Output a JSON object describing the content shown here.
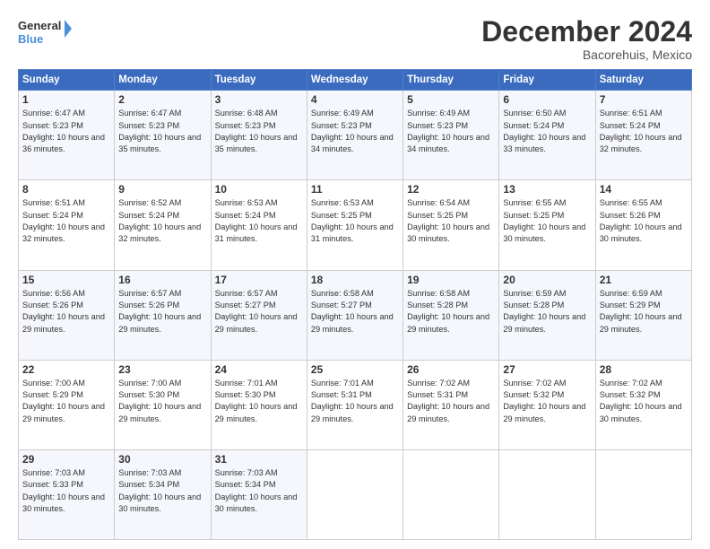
{
  "logo": {
    "general": "General",
    "blue": "Blue"
  },
  "header": {
    "month": "December 2024",
    "location": "Bacorehuis, Mexico"
  },
  "weekdays": [
    "Sunday",
    "Monday",
    "Tuesday",
    "Wednesday",
    "Thursday",
    "Friday",
    "Saturday"
  ],
  "weeks": [
    [
      {
        "day": "1",
        "sunrise": "Sunrise: 6:47 AM",
        "sunset": "Sunset: 5:23 PM",
        "daylight": "Daylight: 10 hours and 36 minutes."
      },
      {
        "day": "2",
        "sunrise": "Sunrise: 6:47 AM",
        "sunset": "Sunset: 5:23 PM",
        "daylight": "Daylight: 10 hours and 35 minutes."
      },
      {
        "day": "3",
        "sunrise": "Sunrise: 6:48 AM",
        "sunset": "Sunset: 5:23 PM",
        "daylight": "Daylight: 10 hours and 35 minutes."
      },
      {
        "day": "4",
        "sunrise": "Sunrise: 6:49 AM",
        "sunset": "Sunset: 5:23 PM",
        "daylight": "Daylight: 10 hours and 34 minutes."
      },
      {
        "day": "5",
        "sunrise": "Sunrise: 6:49 AM",
        "sunset": "Sunset: 5:23 PM",
        "daylight": "Daylight: 10 hours and 34 minutes."
      },
      {
        "day": "6",
        "sunrise": "Sunrise: 6:50 AM",
        "sunset": "Sunset: 5:24 PM",
        "daylight": "Daylight: 10 hours and 33 minutes."
      },
      {
        "day": "7",
        "sunrise": "Sunrise: 6:51 AM",
        "sunset": "Sunset: 5:24 PM",
        "daylight": "Daylight: 10 hours and 32 minutes."
      }
    ],
    [
      {
        "day": "8",
        "sunrise": "Sunrise: 6:51 AM",
        "sunset": "Sunset: 5:24 PM",
        "daylight": "Daylight: 10 hours and 32 minutes."
      },
      {
        "day": "9",
        "sunrise": "Sunrise: 6:52 AM",
        "sunset": "Sunset: 5:24 PM",
        "daylight": "Daylight: 10 hours and 32 minutes."
      },
      {
        "day": "10",
        "sunrise": "Sunrise: 6:53 AM",
        "sunset": "Sunset: 5:24 PM",
        "daylight": "Daylight: 10 hours and 31 minutes."
      },
      {
        "day": "11",
        "sunrise": "Sunrise: 6:53 AM",
        "sunset": "Sunset: 5:25 PM",
        "daylight": "Daylight: 10 hours and 31 minutes."
      },
      {
        "day": "12",
        "sunrise": "Sunrise: 6:54 AM",
        "sunset": "Sunset: 5:25 PM",
        "daylight": "Daylight: 10 hours and 30 minutes."
      },
      {
        "day": "13",
        "sunrise": "Sunrise: 6:55 AM",
        "sunset": "Sunset: 5:25 PM",
        "daylight": "Daylight: 10 hours and 30 minutes."
      },
      {
        "day": "14",
        "sunrise": "Sunrise: 6:55 AM",
        "sunset": "Sunset: 5:26 PM",
        "daylight": "Daylight: 10 hours and 30 minutes."
      }
    ],
    [
      {
        "day": "15",
        "sunrise": "Sunrise: 6:56 AM",
        "sunset": "Sunset: 5:26 PM",
        "daylight": "Daylight: 10 hours and 29 minutes."
      },
      {
        "day": "16",
        "sunrise": "Sunrise: 6:57 AM",
        "sunset": "Sunset: 5:26 PM",
        "daylight": "Daylight: 10 hours and 29 minutes."
      },
      {
        "day": "17",
        "sunrise": "Sunrise: 6:57 AM",
        "sunset": "Sunset: 5:27 PM",
        "daylight": "Daylight: 10 hours and 29 minutes."
      },
      {
        "day": "18",
        "sunrise": "Sunrise: 6:58 AM",
        "sunset": "Sunset: 5:27 PM",
        "daylight": "Daylight: 10 hours and 29 minutes."
      },
      {
        "day": "19",
        "sunrise": "Sunrise: 6:58 AM",
        "sunset": "Sunset: 5:28 PM",
        "daylight": "Daylight: 10 hours and 29 minutes."
      },
      {
        "day": "20",
        "sunrise": "Sunrise: 6:59 AM",
        "sunset": "Sunset: 5:28 PM",
        "daylight": "Daylight: 10 hours and 29 minutes."
      },
      {
        "day": "21",
        "sunrise": "Sunrise: 6:59 AM",
        "sunset": "Sunset: 5:29 PM",
        "daylight": "Daylight: 10 hours and 29 minutes."
      }
    ],
    [
      {
        "day": "22",
        "sunrise": "Sunrise: 7:00 AM",
        "sunset": "Sunset: 5:29 PM",
        "daylight": "Daylight: 10 hours and 29 minutes."
      },
      {
        "day": "23",
        "sunrise": "Sunrise: 7:00 AM",
        "sunset": "Sunset: 5:30 PM",
        "daylight": "Daylight: 10 hours and 29 minutes."
      },
      {
        "day": "24",
        "sunrise": "Sunrise: 7:01 AM",
        "sunset": "Sunset: 5:30 PM",
        "daylight": "Daylight: 10 hours and 29 minutes."
      },
      {
        "day": "25",
        "sunrise": "Sunrise: 7:01 AM",
        "sunset": "Sunset: 5:31 PM",
        "daylight": "Daylight: 10 hours and 29 minutes."
      },
      {
        "day": "26",
        "sunrise": "Sunrise: 7:02 AM",
        "sunset": "Sunset: 5:31 PM",
        "daylight": "Daylight: 10 hours and 29 minutes."
      },
      {
        "day": "27",
        "sunrise": "Sunrise: 7:02 AM",
        "sunset": "Sunset: 5:32 PM",
        "daylight": "Daylight: 10 hours and 29 minutes."
      },
      {
        "day": "28",
        "sunrise": "Sunrise: 7:02 AM",
        "sunset": "Sunset: 5:32 PM",
        "daylight": "Daylight: 10 hours and 30 minutes."
      }
    ],
    [
      {
        "day": "29",
        "sunrise": "Sunrise: 7:03 AM",
        "sunset": "Sunset: 5:33 PM",
        "daylight": "Daylight: 10 hours and 30 minutes."
      },
      {
        "day": "30",
        "sunrise": "Sunrise: 7:03 AM",
        "sunset": "Sunset: 5:34 PM",
        "daylight": "Daylight: 10 hours and 30 minutes."
      },
      {
        "day": "31",
        "sunrise": "Sunrise: 7:03 AM",
        "sunset": "Sunset: 5:34 PM",
        "daylight": "Daylight: 10 hours and 30 minutes."
      },
      null,
      null,
      null,
      null
    ]
  ]
}
